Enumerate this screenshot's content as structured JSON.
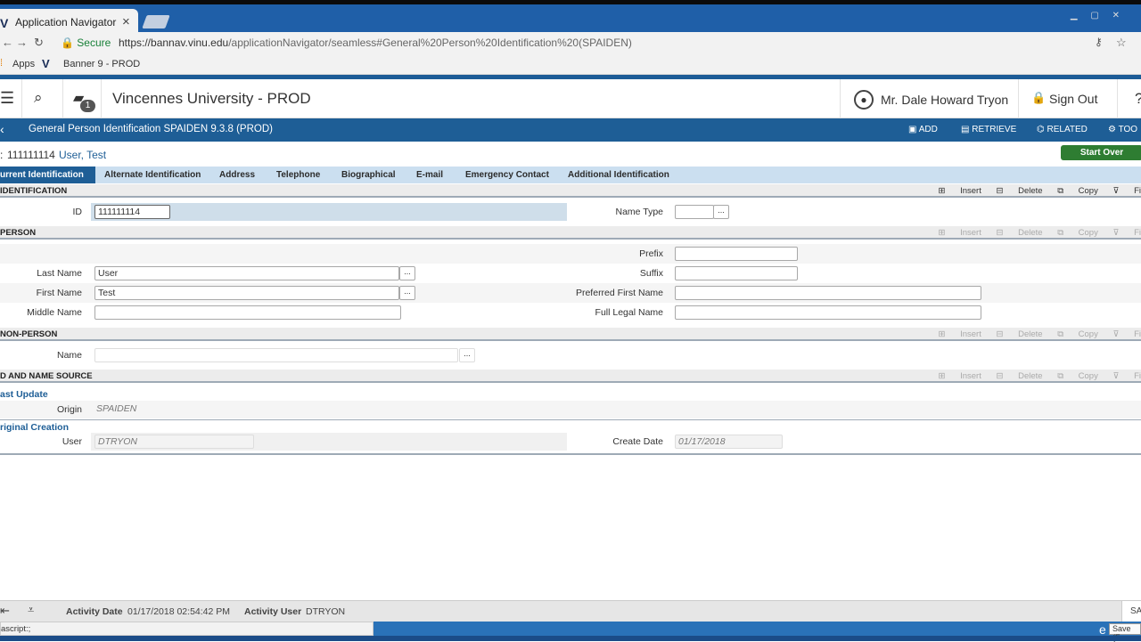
{
  "browser": {
    "tab_favicon": "V",
    "tab_title": "Application Navigator",
    "tab_close": "×",
    "secure_label": "Secure",
    "url_host": "https://bannav.vinu.edu",
    "url_path": "/applicationNavigator/seamless#General%20Person%20Identification%20(SPAIDEN)",
    "bookmarks": {
      "apps": "Apps",
      "banner": "Banner 9 - PROD"
    }
  },
  "app_header": {
    "title": "Vincennes University - PROD",
    "notification_count": "1",
    "user_name": "Mr. Dale Howard Tryon",
    "sign_out": "Sign Out",
    "help": "?"
  },
  "page_header": {
    "title": "General Person Identification SPAIDEN 9.3.8 (PROD)",
    "actions": {
      "add": "ADD",
      "retrieve": "RETRIEVE",
      "related": "RELATED",
      "tools": "TOO"
    }
  },
  "key_block": {
    "prefix": ":",
    "id": "111111114",
    "name": "User, Test",
    "start_over": "Start Over"
  },
  "tabs": [
    "urrent Identification",
    "Alternate Identification",
    "Address",
    "Telephone",
    "Biographical",
    "E-mail",
    "Emergency Contact",
    "Additional Identification"
  ],
  "section_actions": {
    "insert": "Insert",
    "delete": "Delete",
    "copy": "Copy",
    "filter": "Fi"
  },
  "id_section": {
    "header": "IDENTIFICATION",
    "id_label": "ID",
    "id_value": "111111114",
    "name_type_label": "Name Type",
    "name_type_value": ""
  },
  "person_section": {
    "header": "PERSON",
    "last_name_label": "Last Name",
    "last_name_value": "User",
    "first_name_label": "First Name",
    "first_name_value": "Test",
    "middle_name_label": "Middle Name",
    "middle_name_value": "",
    "prefix_label": "Prefix",
    "prefix_value": "",
    "suffix_label": "Suffix",
    "suffix_value": "",
    "preferred_first_name_label": "Preferred First Name",
    "preferred_first_name_value": "",
    "full_legal_name_label": "Full Legal Name",
    "full_legal_name_value": ""
  },
  "nonperson_section": {
    "header": "NON-PERSON",
    "name_label": "Name",
    "name_value": ""
  },
  "source_section": {
    "header": "D AND NAME SOURCE",
    "last_update_label": "ast Update",
    "origin_label": "Origin",
    "origin_value": "SPAIDEN",
    "original_creation_label": "riginal Creation",
    "user_label": "User",
    "user_value": "DTRYON",
    "create_date_label": "Create Date",
    "create_date_value": "01/17/2018"
  },
  "footer": {
    "activity_date_label": "Activity Date",
    "activity_date_value": "01/17/2018 02:54:42 PM",
    "activity_user_label": "Activity User",
    "activity_user_value": "DTRYON",
    "save_partial": "SA"
  },
  "status": {
    "text": "ascript:;",
    "e_glyph": "e",
    "save_tooltip": "Save (F"
  },
  "colors": {
    "accent": "#1e5e96",
    "tab_strip": "#cbdff0",
    "start_over": "#2e7d32"
  }
}
